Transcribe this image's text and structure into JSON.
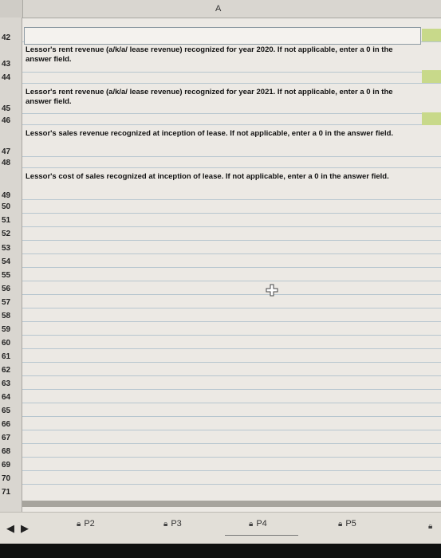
{
  "header": {
    "column_label": "A"
  },
  "rows": {
    "numbers": [
      "42",
      "43",
      "44",
      "45",
      "46",
      "47",
      "48",
      "49",
      "50",
      "51",
      "52",
      "53",
      "54",
      "55",
      "56",
      "57",
      "58",
      "59",
      "60",
      "61",
      "62",
      "63",
      "64",
      "65",
      "66",
      "67",
      "68",
      "69",
      "70",
      "71"
    ]
  },
  "prompts": [
    "Lessor's rent revenue (a/k/a/ lease revenue) recognized for year 2020. If not applicable, enter a 0 in the answer field.",
    "Lessor's rent revenue (a/k/a/ lease revenue) recognized for year 2021. If not applicable, enter a 0 in the answer field.",
    "Lessor's sales revenue recognized at inception of lease. If not applicable, enter a 0 in the answer field.",
    "Lessor's cost of sales recognized at inception of lease. If not applicable, enter a 0 in the answer field."
  ],
  "icons": {
    "cursor": "crosshair-cursor-icon",
    "lock": "lock-icon"
  },
  "tabs": [
    {
      "label": "P2"
    },
    {
      "label": "P3"
    },
    {
      "label": "P4"
    },
    {
      "label": "P5"
    }
  ],
  "colors": {
    "green_cell": "#c8d98a",
    "gridline": "#b7c6cf"
  }
}
